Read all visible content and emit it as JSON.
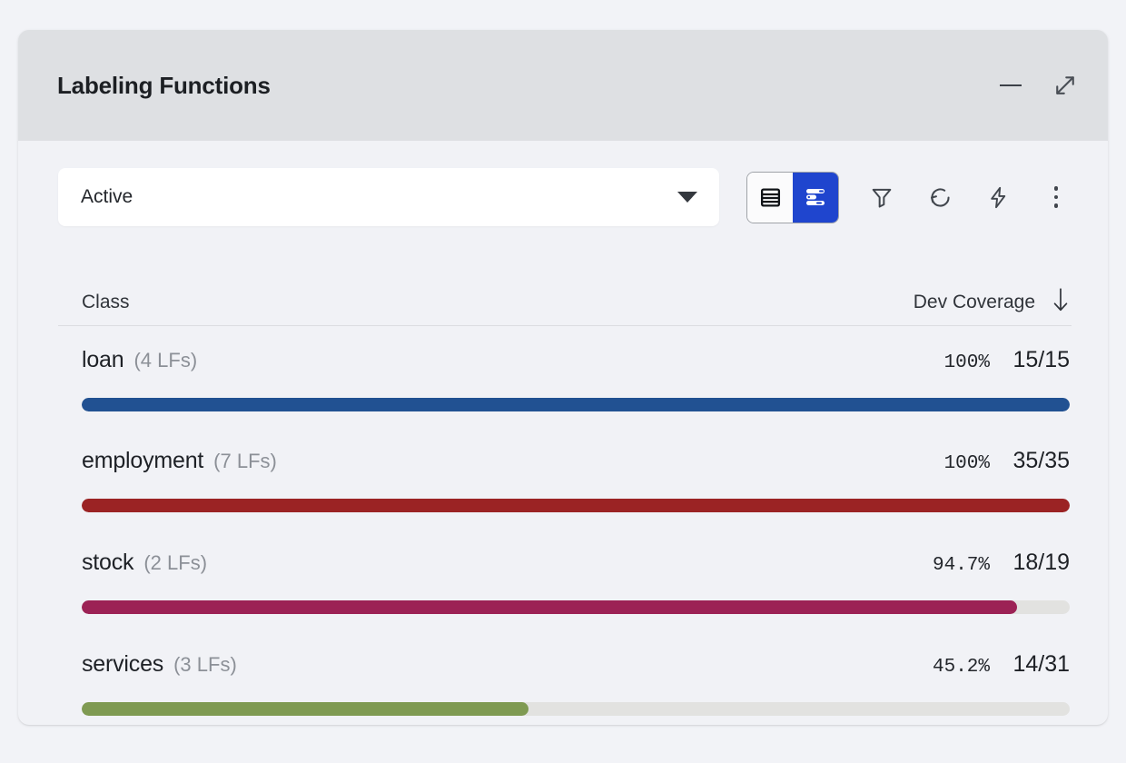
{
  "panel": {
    "title": "Labeling Functions",
    "minimize_icon": "minimize-icon",
    "expand_icon": "expand-diagonal-icon"
  },
  "toolbar": {
    "status_select": {
      "value": "Active",
      "caret_icon": "chevron-down-icon"
    },
    "view_toggle": {
      "options": [
        {
          "name": "list-view",
          "icon": "list-view-icon",
          "active": false
        },
        {
          "name": "chart-view",
          "icon": "bar-chart-view-icon",
          "active": true
        }
      ],
      "active_color": "#1f45ce"
    },
    "actions": [
      {
        "name": "filter",
        "icon": "funnel-icon"
      },
      {
        "name": "refresh",
        "icon": "refresh-icon"
      },
      {
        "name": "quick-actions",
        "icon": "lightning-bolt-icon"
      },
      {
        "name": "more-options",
        "icon": "more-vertical-icon"
      }
    ]
  },
  "table": {
    "headers": {
      "class": "Class",
      "coverage": "Dev Coverage",
      "sort_icon": "arrow-down-icon",
      "sort_direction": "descending"
    },
    "rows": [
      {
        "class": "loan",
        "lfs": "(4 LFs)",
        "percent": "100%",
        "count": "15/15",
        "fill_pct": 100,
        "color": "#215192"
      },
      {
        "class": "employment",
        "lfs": "(7 LFs)",
        "percent": "100%",
        "count": "35/35",
        "fill_pct": 100,
        "color": "#9b2324"
      },
      {
        "class": "stock",
        "lfs": "(2 LFs)",
        "percent": "94.7%",
        "count": "18/19",
        "fill_pct": 94.7,
        "color": "#9c2255"
      },
      {
        "class": "services",
        "lfs": "(3 LFs)",
        "percent": "45.2%",
        "count": "14/31",
        "fill_pct": 45.2,
        "color": "#7f9a52"
      }
    ]
  },
  "chart_data": {
    "type": "bar",
    "title": "Dev Coverage by Class",
    "categories": [
      "loan",
      "employment",
      "stock",
      "services"
    ],
    "values": [
      100,
      100,
      94.7,
      45.2
    ],
    "counts": [
      "15/15",
      "35/35",
      "18/19",
      "14/31"
    ],
    "lf_counts": [
      4,
      7,
      2,
      3
    ],
    "colors": [
      "#215192",
      "#9b2324",
      "#9c2255",
      "#7f9a52"
    ],
    "xlabel": "",
    "ylabel": "Dev Coverage",
    "ylim": [
      0,
      100
    ],
    "orientation": "horizontal",
    "grid": false,
    "legend": "none"
  }
}
